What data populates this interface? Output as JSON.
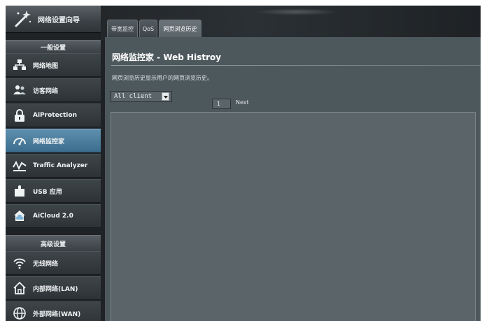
{
  "sidebar": {
    "wizard_label": "网络设置向导",
    "general_header": "一般设置",
    "advanced_header": "高级设置",
    "general_items": [
      {
        "label": "网络地图",
        "icon": "network-map-icon"
      },
      {
        "label": "访客网络",
        "icon": "guest-network-icon"
      },
      {
        "label": "AiProtection",
        "icon": "aiprotection-lock-icon"
      },
      {
        "label": "网络监控家",
        "icon": "speedometer-icon",
        "active": true
      },
      {
        "label": "Traffic Analyzer",
        "icon": "traffic-analyzer-icon"
      },
      {
        "label": "USB 应用",
        "icon": "usb-puzzle-icon"
      },
      {
        "label": "AiCloud 2.0",
        "icon": "aicloud-icon"
      }
    ],
    "advanced_items": [
      {
        "label": "无线网络",
        "icon": "wifi-icon"
      },
      {
        "label": "内部网络(LAN)",
        "icon": "home-lan-icon"
      },
      {
        "label": "外部网络(WAN)",
        "icon": "globe-wan-icon"
      }
    ]
  },
  "tabs": [
    {
      "label": "带宽监控",
      "active": false
    },
    {
      "label": "QoS",
      "active": false
    },
    {
      "label": "网页浏览历史",
      "active": true
    }
  ],
  "main": {
    "title": "网络监控家 - Web Histroy",
    "description": "网页浏览历史显示用户的网页浏览历史。",
    "client_select_value": "All client",
    "page_number": "1",
    "next_label": "Next"
  },
  "colors": {
    "active_item": "#4f82a3",
    "panel_bg": "#4d585d",
    "content_bg": "#5b6569"
  }
}
